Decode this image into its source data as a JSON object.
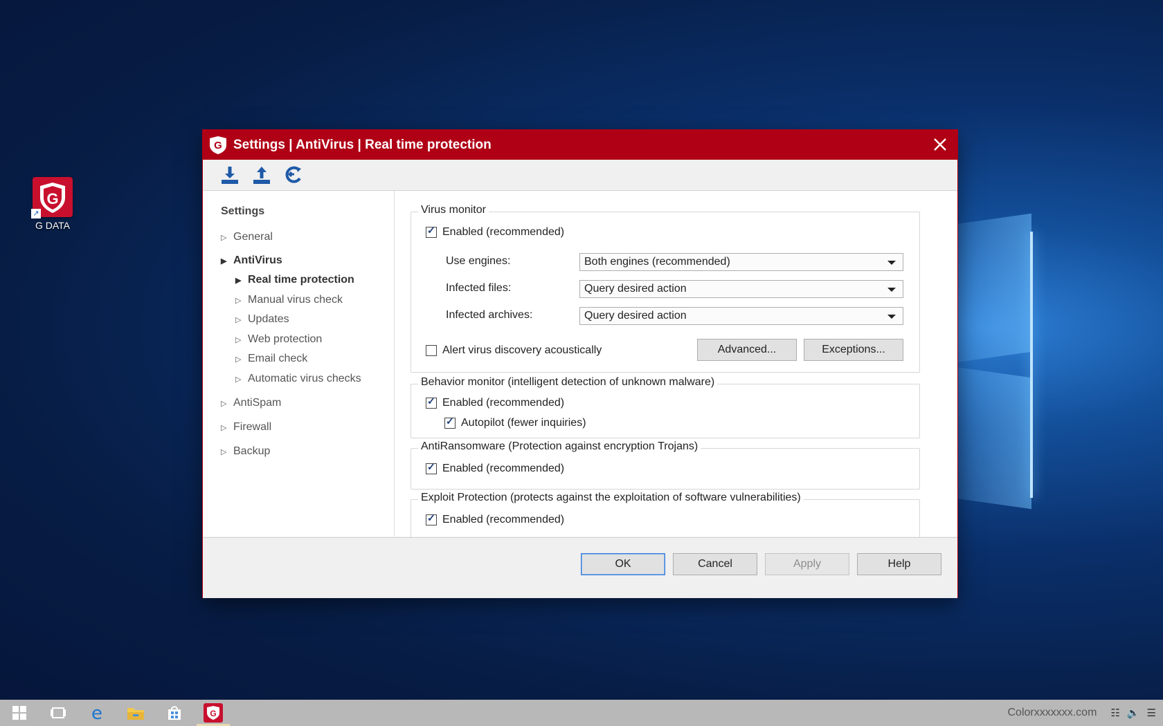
{
  "desktop": {
    "icon_label": "G DATA"
  },
  "window": {
    "title": "Settings | AntiVirus | Real time protection",
    "accent_color": "#b00015",
    "toolbar": [
      "download-icon",
      "upload-icon",
      "reset-icon"
    ]
  },
  "nav": {
    "header": "Settings",
    "items": [
      {
        "label": "General",
        "level": 0,
        "expanded": false
      },
      {
        "label": "AntiVirus",
        "level": 0,
        "expanded": true
      },
      {
        "label": "Real time protection",
        "level": 1,
        "selected": true
      },
      {
        "label": "Manual virus check",
        "level": 1
      },
      {
        "label": "Updates",
        "level": 1
      },
      {
        "label": "Web protection",
        "level": 1
      },
      {
        "label": "Email check",
        "level": 1
      },
      {
        "label": "Automatic virus checks",
        "level": 1
      },
      {
        "label": "AntiSpam",
        "level": 0
      },
      {
        "label": "Firewall",
        "level": 0
      },
      {
        "label": "Backup",
        "level": 0
      }
    ]
  },
  "virus_monitor": {
    "title": "Virus monitor",
    "enabled_label": "Enabled (recommended)",
    "enabled": true,
    "engines_label": "Use engines:",
    "engines_value": "Both engines (recommended)",
    "infected_files_label": "Infected files:",
    "infected_files_value": "Query desired action",
    "infected_archives_label": "Infected archives:",
    "infected_archives_value": "Query desired action",
    "alert_label": "Alert virus discovery acoustically",
    "alert": false,
    "advanced_button": "Advanced...",
    "exceptions_button": "Exceptions..."
  },
  "behavior_monitor": {
    "title": "Behavior monitor (intelligent detection of unknown malware)",
    "enabled_label": "Enabled (recommended)",
    "enabled": true,
    "autopilot_label": "Autopilot (fewer inquiries)",
    "autopilot": true
  },
  "antiransomware": {
    "title": "AntiRansomware (Protection against encryption Trojans)",
    "enabled_label": "Enabled (recommended)",
    "enabled": true
  },
  "exploit_protection": {
    "title": "Exploit Protection (protects against the exploitation of software vulnerabilities)",
    "enabled_label": "Enabled (recommended)",
    "enabled": true
  },
  "footer": {
    "ok": "OK",
    "cancel": "Cancel",
    "apply": "Apply",
    "help": "Help"
  },
  "taskbar": {
    "icons": [
      "windows-start-icon",
      "task-view-icon",
      "edge-icon",
      "file-explorer-icon",
      "store-icon",
      "gdata-taskbar-icon"
    ],
    "watermark": "Colorxxxxxxx.com"
  }
}
